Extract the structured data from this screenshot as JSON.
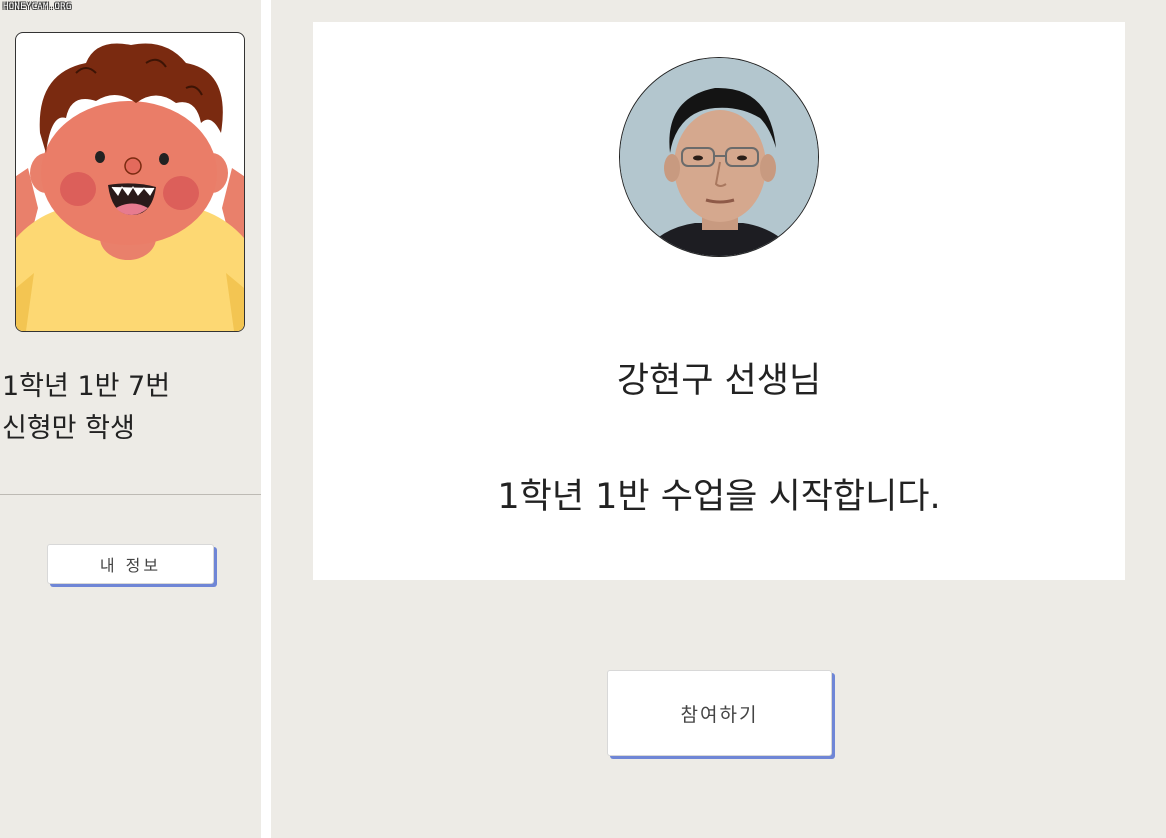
{
  "watermark": "HONEYCAM.ORG",
  "sidebar": {
    "avatar_icon": "cartoon-boy-avatar",
    "student_class": "1학년 1반 7번",
    "student_name": "신형만 학생",
    "my_info_label": "내 정보"
  },
  "main": {
    "teacher_photo_icon": "teacher-portrait",
    "teacher_name": "강현구 선생님",
    "message": "1학년 1반 수업을 시작합니다.",
    "join_label": "참여하기"
  },
  "colors": {
    "background": "#edebe6",
    "card": "#ffffff",
    "button_shadow": "#6f86d6",
    "text": "#222222"
  }
}
